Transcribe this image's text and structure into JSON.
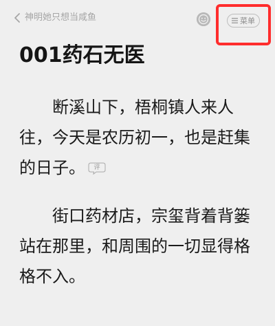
{
  "header": {
    "book_title": "神明她只想当咸鱼",
    "menu_label": "菜单"
  },
  "chapter": {
    "title": "001药石无医",
    "paragraphs": [
      "断溪山下，梧桐镇人来人往，今天是农历初一，也是赶集的日子。",
      "街口药材店，宗玺背着背篓站在那里，和周围的一切显得格格不入。"
    ],
    "comment_badge": "评"
  },
  "icons": {
    "back": "chevron-left-icon",
    "emoji": "smiley-icon",
    "menu": "menu-lines-icon",
    "comment": "comment-bubble-icon"
  },
  "colors": {
    "background": "#efefef",
    "highlight": "#ff2d2d",
    "muted": "#a6a6a6",
    "text": "#1a1a1a"
  }
}
